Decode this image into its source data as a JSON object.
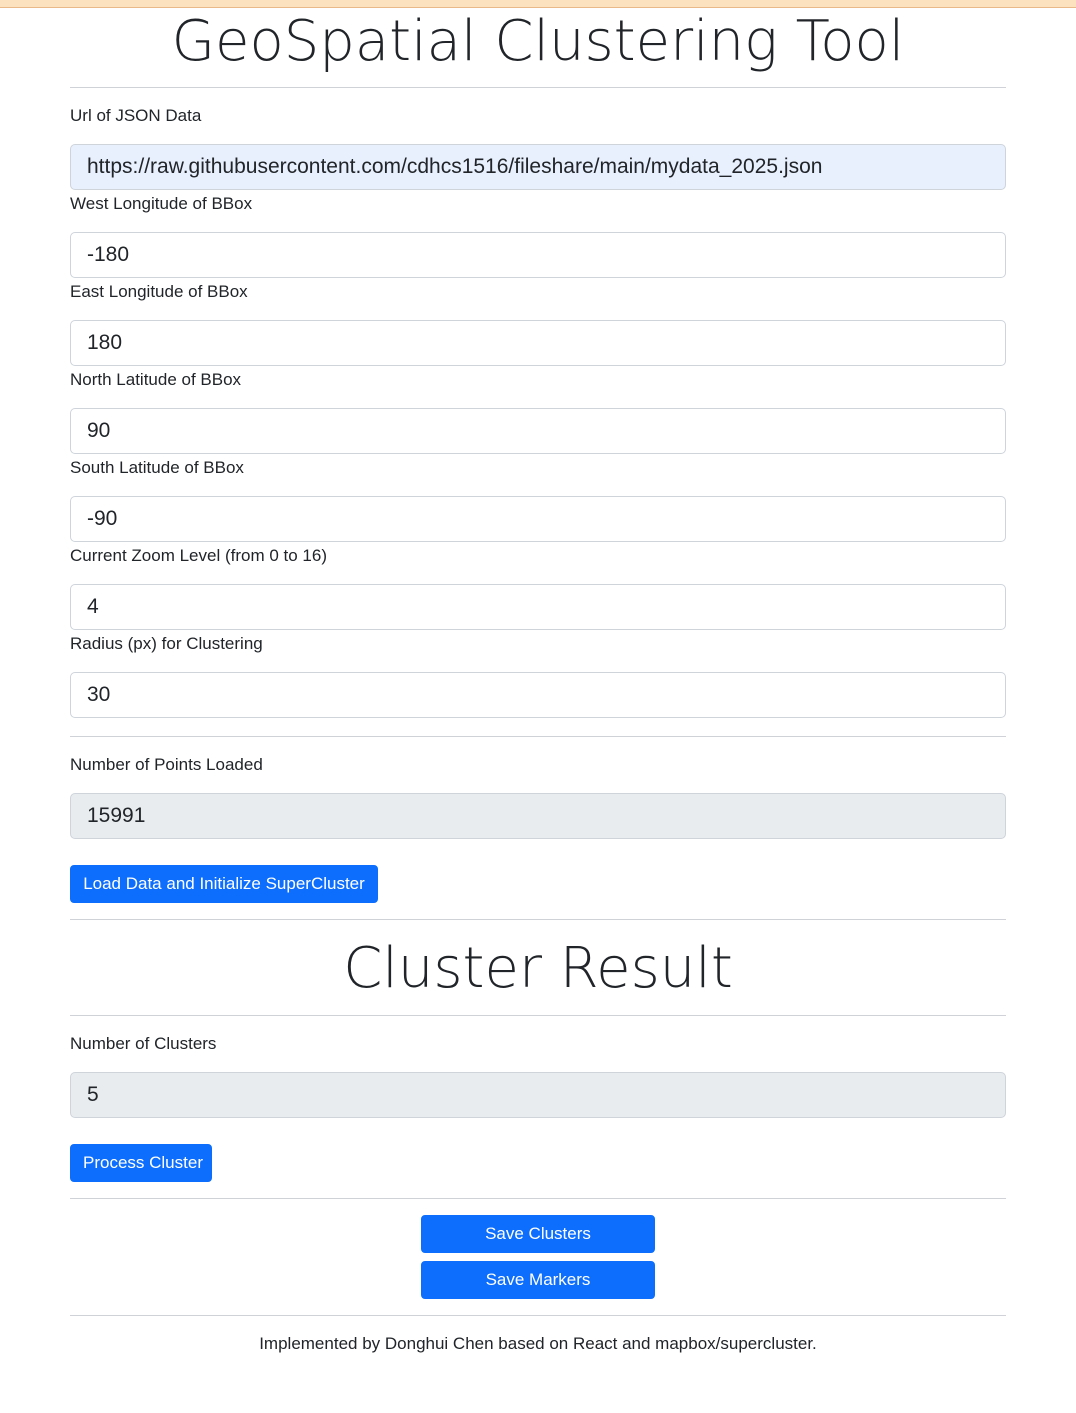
{
  "header": {
    "title": "GeoSpatial Clustering Tool"
  },
  "form": {
    "url": {
      "label": "Url of JSON Data",
      "value": "https://raw.githubusercontent.com/cdhcs1516/fileshare/main/mydata_2025.json"
    },
    "west": {
      "label": "West Longitude of BBox",
      "value": "-180"
    },
    "east": {
      "label": "East Longitude of BBox",
      "value": "180"
    },
    "north": {
      "label": "North Latitude of BBox",
      "value": "90"
    },
    "south": {
      "label": "South Latitude of BBox",
      "value": "-90"
    },
    "zoom": {
      "label": "Current Zoom Level (from 0 to 16)",
      "value": "4"
    },
    "radius": {
      "label": "Radius (px) for Clustering",
      "value": "30"
    }
  },
  "points": {
    "label": "Number of Points Loaded",
    "value": "15991",
    "button_label": "Load Data and Initialize SuperCluster"
  },
  "result": {
    "title": "Cluster Result",
    "clusters_label": "Number of Clusters",
    "clusters_value": "5",
    "process_button_label": "Process Cluster"
  },
  "actions": {
    "save_clusters_label": "Save Clusters",
    "save_markers_label": "Save Markers"
  },
  "footer": {
    "text": "Implemented by Donghui Chen based on React and mapbox/supercluster."
  },
  "colors": {
    "primary": "#0d6efd",
    "autofill_bg": "#e8f0fe",
    "readonly_bg": "#e9ecef",
    "top_strip": "#fde2bf"
  }
}
